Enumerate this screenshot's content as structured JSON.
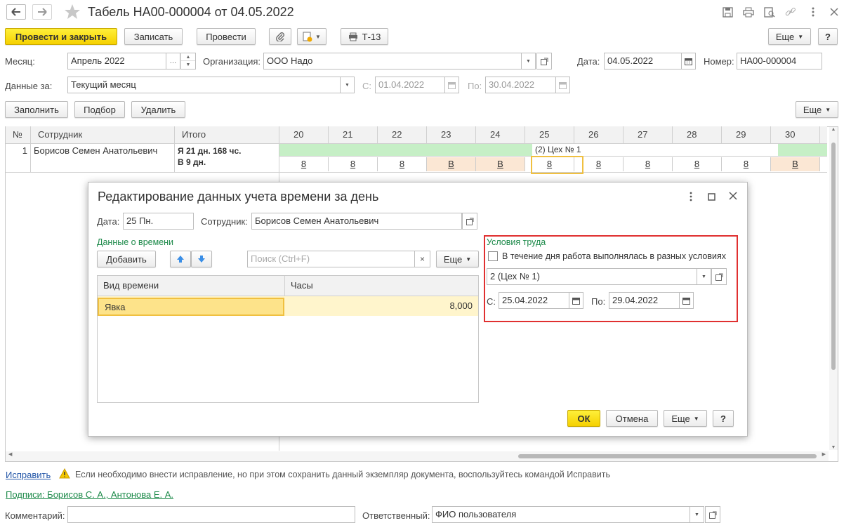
{
  "window": {
    "title": "Табель НА00-000004 от 04.05.2022"
  },
  "toolbar": {
    "post_close": "Провести и закрыть",
    "save": "Записать",
    "post": "Провести",
    "t13": "Т-13",
    "more": "Еще",
    "help": "?"
  },
  "form": {
    "month_label": "Месяц:",
    "month_value": "Апрель 2022",
    "org_label": "Организация:",
    "org_value": "ООО Надо",
    "date_label": "Дата:",
    "date_value": "04.05.2022",
    "number_label": "Номер:",
    "number_value": "НА00-000004",
    "data_for_label": "Данные за:",
    "data_for_value": "Текущий месяц",
    "from_label": "С:",
    "from_value": "01.04.2022",
    "to_label": "По:",
    "to_value": "30.04.2022"
  },
  "table_toolbar": {
    "fill": "Заполнить",
    "select": "Подбор",
    "delete": "Удалить",
    "more": "Еще"
  },
  "grid": {
    "headers": {
      "num": "№",
      "employee": "Сотрудник",
      "total": "Итого"
    },
    "days": [
      "20",
      "21",
      "22",
      "23",
      "24",
      "25",
      "26",
      "27",
      "28",
      "29",
      "30"
    ],
    "row": {
      "num": "1",
      "employee": "Борисов Семен Анатольевич",
      "total_line1": "Я 21 дн. 168 чс.",
      "total_line2": "В 9 дн.",
      "condition_label": "(2) Цех № 1",
      "values": [
        "8",
        "8",
        "8",
        "В",
        "В",
        "8",
        "8",
        "8",
        "8",
        "8",
        "В"
      ]
    }
  },
  "footer": {
    "fix_link": "Исправить",
    "warning": "Если необходимо внести исправление, но при этом сохранить данный экземпляр документа, воспользуйтесь командой Исправить",
    "signatures": "Подписи: Борисов С. А., Антонова Е. А.",
    "comment_label": "Комментарий:",
    "comment_value": "",
    "responsible_label": "Ответственный:",
    "responsible_value": "ФИО пользователя"
  },
  "dialog": {
    "title": "Редактирование данных учета времени за день",
    "date_label": "Дата:",
    "date_value": "25 Пн.",
    "employee_label": "Сотрудник:",
    "employee_value": "Борисов Семен Анатольевич",
    "time_data_label": "Данные о времени",
    "add": "Добавить",
    "search_placeholder": "Поиск (Ctrl+F)",
    "more": "Еще",
    "col_type": "Вид времени",
    "col_hours": "Часы",
    "rows": [
      {
        "type": "Явка",
        "hours": "8,000"
      }
    ],
    "conditions_title": "Условия труда",
    "different_conditions": "В течение дня работа выполнялась в разных условиях",
    "condition_value": "2 (Цех № 1)",
    "c_from_label": "С:",
    "c_from_value": "25.04.2022",
    "c_to_label": "По:",
    "c_to_value": "29.04.2022",
    "ok": "ОК",
    "cancel": "Отмена",
    "help": "?"
  }
}
